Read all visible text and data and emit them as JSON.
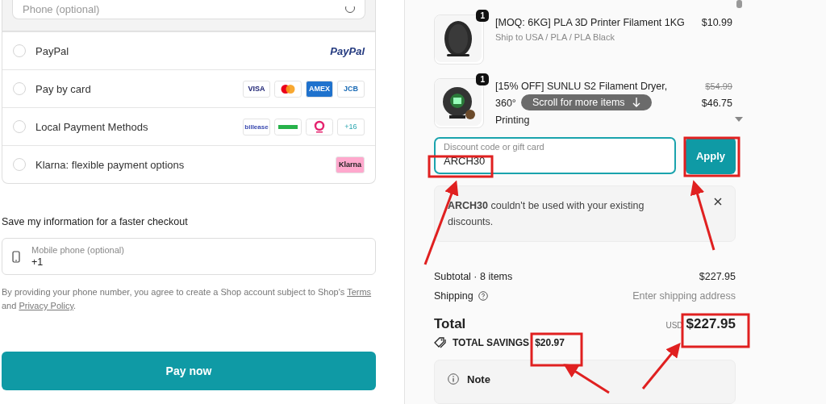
{
  "contact": {
    "phone_placeholder": "Phone (optional)"
  },
  "payment_methods": [
    {
      "label": "PayPal",
      "selected": false,
      "logos": [
        {
          "kind": "paypal",
          "text": "PayPal"
        }
      ]
    },
    {
      "label": "Pay by card",
      "selected": false,
      "logos": [
        {
          "kind": "visa",
          "text": "VISA"
        },
        {
          "kind": "mastercard"
        },
        {
          "kind": "amex",
          "text": "AMEX"
        },
        {
          "kind": "jcb",
          "text": "JCB"
        }
      ]
    },
    {
      "label": "Local Payment Methods",
      "selected": false,
      "logos": [
        {
          "kind": "billease",
          "text": "billease"
        },
        {
          "kind": "greenpay"
        },
        {
          "kind": "duitnow"
        },
        {
          "kind": "more",
          "text": "+16"
        }
      ]
    },
    {
      "label": "Klarna: flexible payment options",
      "selected": false,
      "logos": [
        {
          "kind": "klarna",
          "text": "Klarna"
        }
      ]
    }
  ],
  "save_info": {
    "title": "Save my information for a faster checkout",
    "mobile_label": "Mobile phone (optional)",
    "mobile_value": "+1",
    "disclaimer": "By providing your phone number, you agree to create a Shop account subject to Shop's ",
    "terms_link": "Terms",
    "and": "and ",
    "privacy_link": "Privacy Policy",
    "end": "."
  },
  "pay_button": "Pay now",
  "cart_items": [
    {
      "quantity": "1",
      "title_lines": [
        "[MOQ: 6KG] PLA 3D Printer Filament 1KG"
      ],
      "variant": "Ship to USA / PLA / PLA Black",
      "price": "$10.99",
      "kind": "spool"
    },
    {
      "quantity": "1",
      "title_lines": [
        "[15% OFF] SUNLU S2 Filament Dryer,",
        "360°",
        "Printing"
      ],
      "old_price": "$54.99",
      "price": "$46.75",
      "kind": "dryer"
    }
  ],
  "scroll_hint": "Scroll for more items",
  "discount": {
    "label": "Discount code or gift card",
    "value": "ARCH30",
    "button": "Apply"
  },
  "error": {
    "message": "**ARCH30** couldn't be used with your existing discounts."
  },
  "summary": {
    "subtotal_label": "Subtotal · 8 items",
    "subtotal": "$227.95",
    "shipping_label": "Shipping",
    "shipping_value": "Enter shipping address",
    "total_label": "Total",
    "currency": "USD",
    "total": "$227.95",
    "savings_label": "TOTAL SAVINGS",
    "savings": "$20.97"
  },
  "note": {
    "title": "Note"
  }
}
